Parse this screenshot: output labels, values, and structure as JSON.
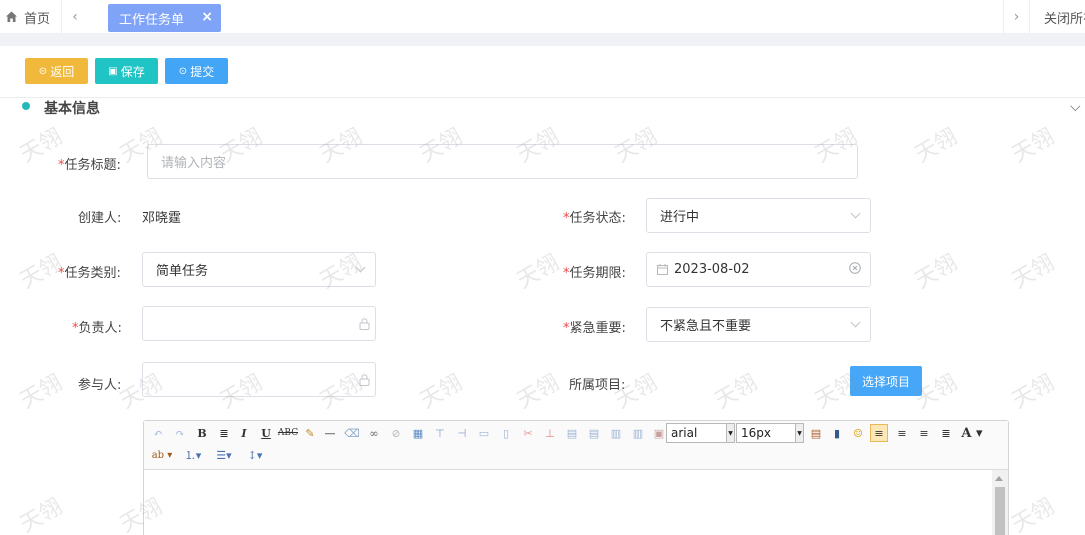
{
  "tabs": {
    "home_label": "首页",
    "active_label": "工作任务单",
    "close_all_label": "关闭所有"
  },
  "toolbar": {
    "back_label": "返回",
    "save_label": "保存",
    "submit_label": "提交"
  },
  "section": {
    "title": "基本信息"
  },
  "form": {
    "task_title": {
      "label": "任务标题:",
      "placeholder": "请输入内容"
    },
    "creator": {
      "label": "创建人:",
      "value": "邓晓霆"
    },
    "status": {
      "label": "任务状态:",
      "value": "进行中"
    },
    "category": {
      "label": "任务类别:",
      "value": "简单任务"
    },
    "deadline": {
      "label": "任务期限:",
      "value": "2023-08-02"
    },
    "owner": {
      "label": "负责人:",
      "value": ""
    },
    "priority": {
      "label": "紧急重要:",
      "value": "不紧急且不重要"
    },
    "participants": {
      "label": "参与人:",
      "value": ""
    },
    "project": {
      "label": "所属项目:",
      "button_label": "选择项目"
    }
  },
  "editor": {
    "font_family": "arial",
    "font_size": "16px"
  },
  "watermark": {
    "text": "天翎"
  },
  "colors": {
    "active_tab": "#7fa3f6",
    "back_button": "#f0b93b",
    "save_button": "#21c4c4",
    "submit_button": "#43a5f5",
    "required_mark": "#f04848"
  }
}
